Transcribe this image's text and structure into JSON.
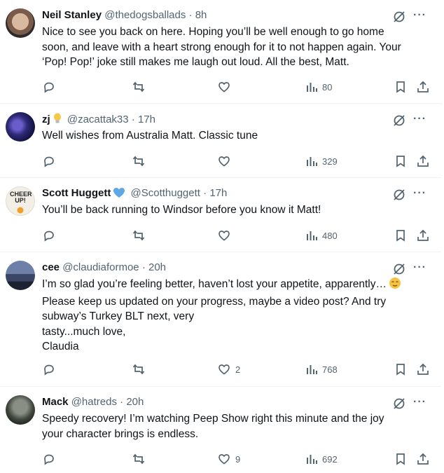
{
  "tweets": [
    {
      "name": "Neil Stanley",
      "handle": "@thedogsballads",
      "sep": "·",
      "time": "8h",
      "text": "Nice to see you back on here. Hoping you’ll be well enough to go home\nsoon, and leave with a heart strong enough for it to not happen again. Your\n‘Pop! Pop!’ joke still makes me laugh out loud. All the best, Matt.",
      "likes": "",
      "views": "80"
    },
    {
      "name": "zj",
      "handle": "@zacattak33",
      "sep": "·",
      "time": "17h",
      "text": "Well wishes from Australia Matt. Classic tune",
      "likes": "",
      "views": "329",
      "badge_icon": "lightbulb-emoji"
    },
    {
      "name": "Scott Huggett",
      "handle": "@Scotthuggett",
      "sep": "·",
      "time": "17h",
      "text": "You’ll be back running to Windsor before you know it Matt!",
      "likes": "",
      "views": "480",
      "badge_icon": "blue-heart-emoji",
      "avatar_text": "CHEER UP!"
    },
    {
      "name": "cee",
      "handle": "@claudiaformoe",
      "sep": "·",
      "time": "20h",
      "text": "I’m so glad you’re feeling better, haven’t lost your appetite, apparently…",
      "text2": "Please keep us updated on your progress, maybe a video post? And try\nsubway’s Turkey BLT next, very\ntasty...much love,\nClaudia",
      "likes": "2",
      "views": "768",
      "end_icon": "relieved-face-emoji"
    },
    {
      "name": "Mack",
      "handle": "@hatreds",
      "sep": "·",
      "time": "20h",
      "text": "Speedy recovery! I’m watching Peep Show right this minute and the joy\nyour character brings is endless.",
      "likes": "9",
      "views": "692"
    }
  ],
  "colors": {
    "text": "#0f1419",
    "muted": "#536471",
    "divider": "#eff3f4"
  }
}
